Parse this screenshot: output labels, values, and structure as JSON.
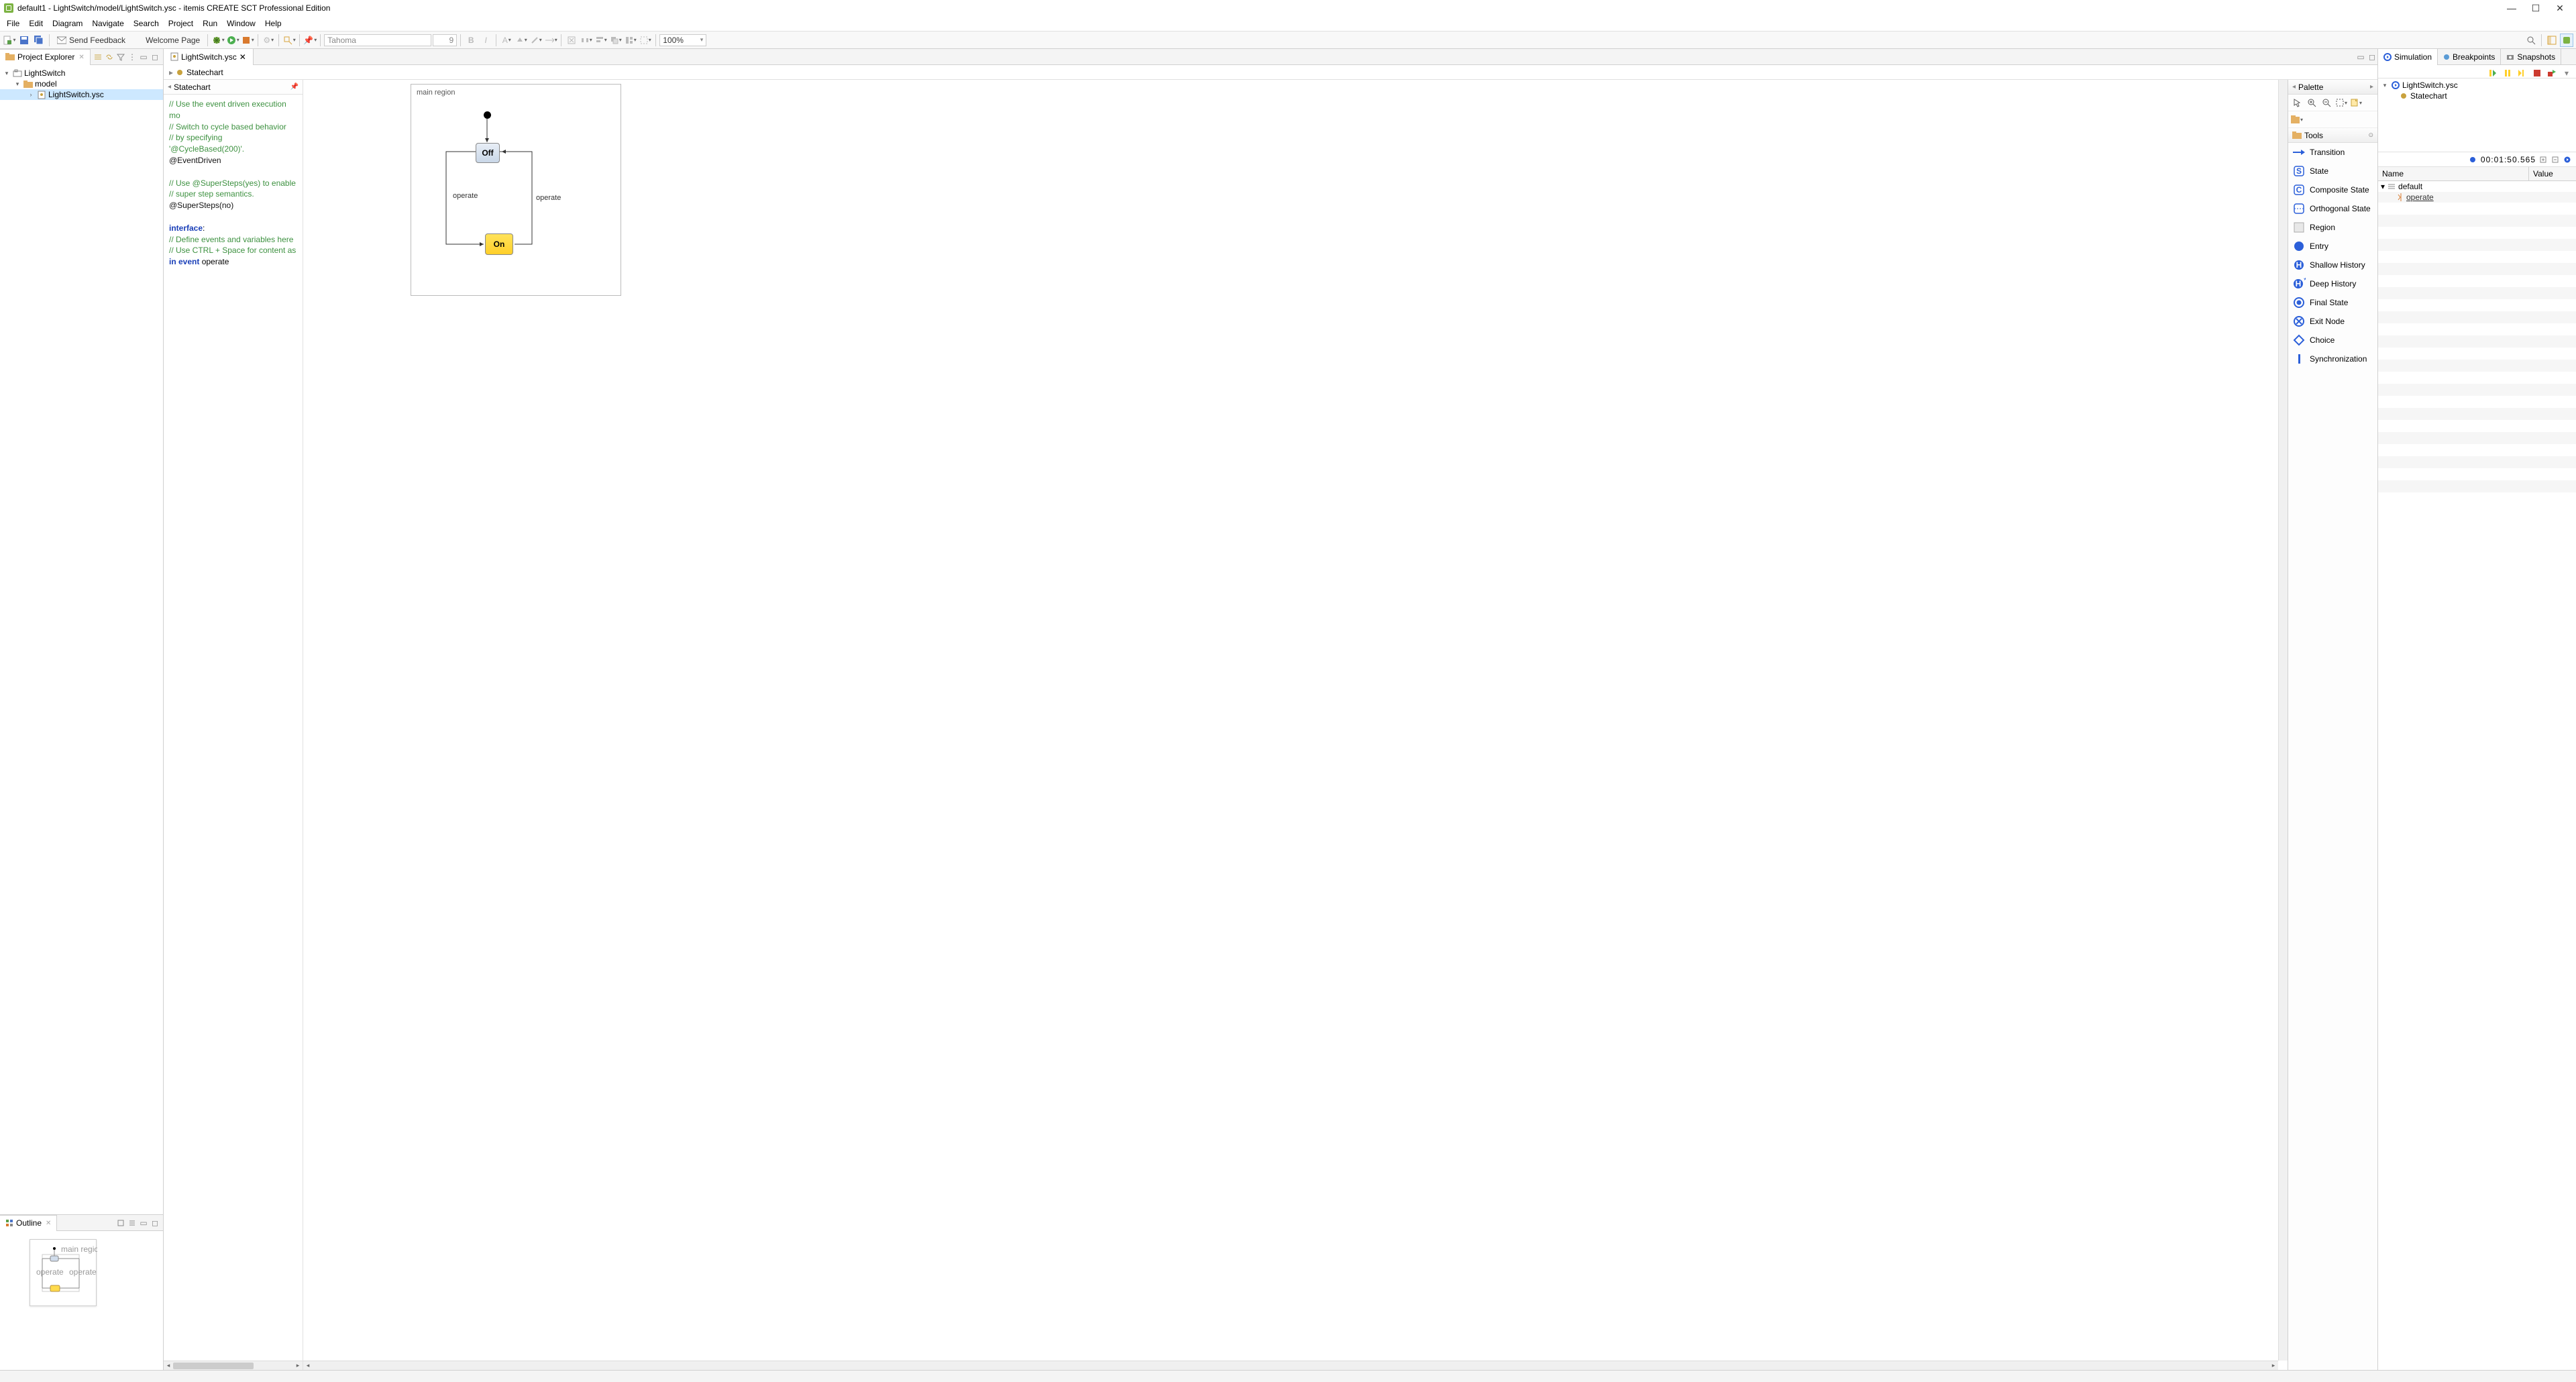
{
  "window": {
    "title": "default1 - LightSwitch/model/LightSwitch.ysc - itemis CREATE SCT Professional Edition"
  },
  "menu": [
    "File",
    "Edit",
    "Diagram",
    "Navigate",
    "Search",
    "Project",
    "Run",
    "Window",
    "Help"
  ],
  "toolbar": {
    "send_feedback": "Send Feedback",
    "welcome_page": "Welcome Page",
    "font": "Tahoma",
    "font_size": "9",
    "zoom": "100%"
  },
  "project_explorer": {
    "title": "Project Explorer",
    "root": "LightSwitch",
    "model": "model",
    "file": "LightSwitch.ysc"
  },
  "outline": {
    "title": "Outline"
  },
  "editor": {
    "tab": "LightSwitch.ysc",
    "breadcrumb": "Statechart",
    "def_header": "Statechart",
    "def_lines": {
      "c1": "// Use the event driven execution mo",
      "c2": "// Switch to cycle based behavior",
      "c3": "// by specifying '@CycleBased(200)'.",
      "a1": "@EventDriven",
      "c4": "// Use @SuperSteps(yes) to enable",
      "c5": "// super step semantics.",
      "a2": "@SuperSteps(no)",
      "kw1": "interface",
      "colon": ":",
      "c6": "// Define events and variables here",
      "c7": "// Use CTRL + Space for content as",
      "kw2": "in event",
      "ev": " operate"
    },
    "region_title": "main region",
    "state_off": "Off",
    "state_on": "On",
    "edge_left": "operate",
    "edge_right": "operate"
  },
  "palette": {
    "title": "Palette",
    "tools": "Tools",
    "items": {
      "transition": "Transition",
      "state": "State",
      "composite": "Composite State",
      "orthogonal": "Orthogonal State",
      "region": "Region",
      "entry": "Entry",
      "shallow": "Shallow History",
      "deep": "Deep History",
      "final": "Final State",
      "exit": "Exit Node",
      "choice": "Choice",
      "sync": "Synchronization"
    }
  },
  "simulation": {
    "tabs": {
      "sim": "Simulation",
      "bp": "Breakpoints",
      "snap": "Snapshots"
    },
    "tree_root": "LightSwitch.ysc",
    "tree_child": "Statechart",
    "time": "00:01:50.565",
    "col_name": "Name",
    "col_value": "Value",
    "row_default": "default",
    "row_event": "operate"
  }
}
